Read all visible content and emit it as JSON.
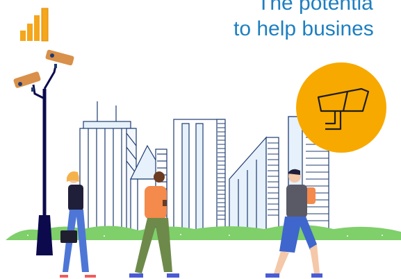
{
  "headline": {
    "line1": "The potentia",
    "line2": "to help busines"
  },
  "colors": {
    "headline_blue": "#1e7fc0",
    "signal_orange": "#f4a61c",
    "badge_orange": "#f7a900",
    "camera_orange": "#d9904a",
    "pole_navy": "#0c0a4d",
    "grass_green": "#7fcf6a",
    "building_outline": "#1d3b70",
    "building_fill": "#e6f1fb"
  },
  "icons": {
    "signal": "signal-bars-icon",
    "camera_badge": "security-camera-icon",
    "pole_camera_top": "cctv-camera-icon",
    "pole_camera_left": "cctv-camera-icon"
  }
}
